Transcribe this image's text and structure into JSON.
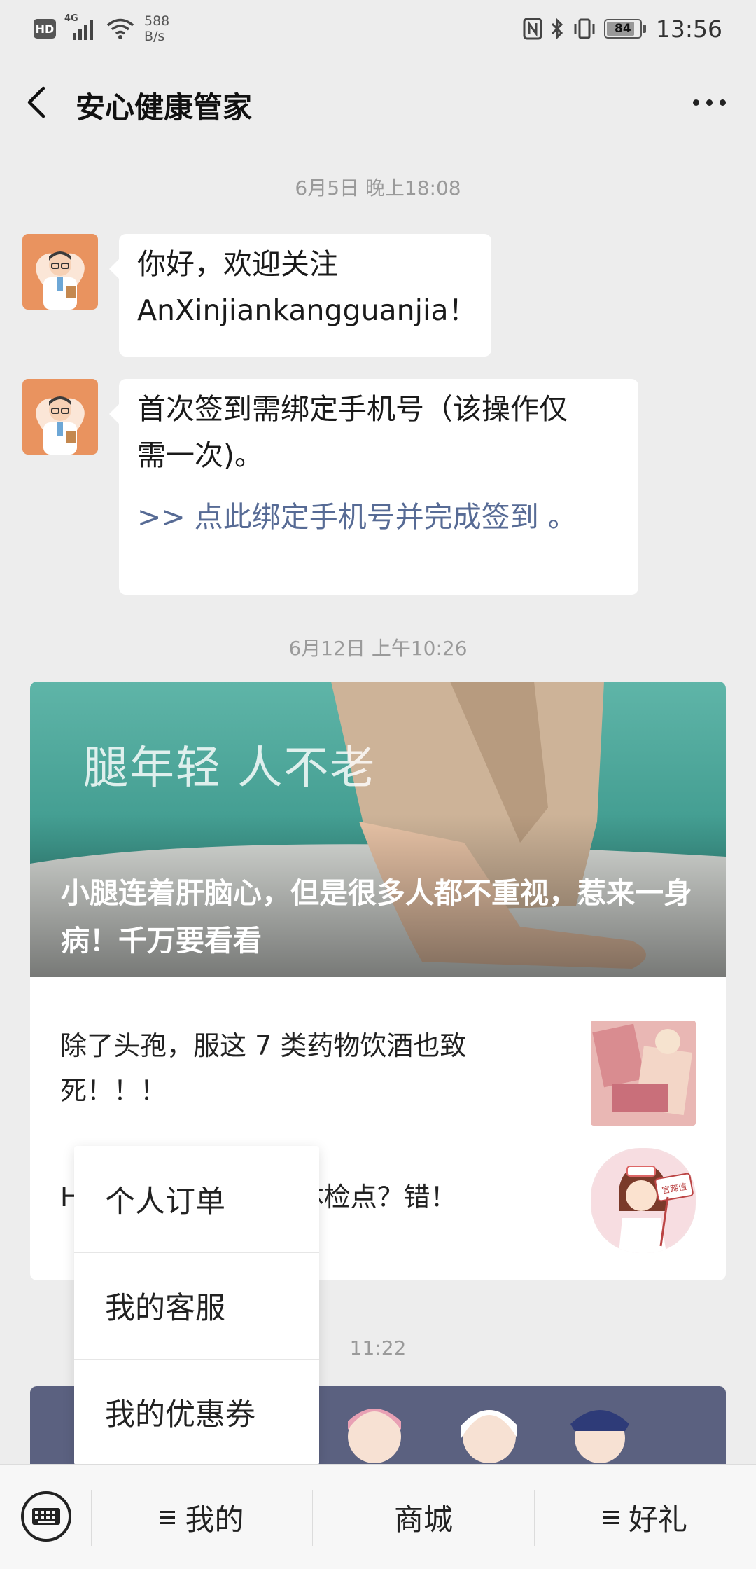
{
  "status_bar": {
    "hd": "HD",
    "network": "4G",
    "speed_value": "588",
    "speed_unit": "B/s",
    "battery": "84",
    "battery_level": 0.84,
    "time": "13:56"
  },
  "header": {
    "title": "安心健康管家"
  },
  "chat": {
    "timestamp_1": "6月5日 晚上18:08",
    "message_1_line1": "你好，欢迎关注",
    "message_1_line2": "AnXinjiankangguanjia！",
    "message_2_line1": "首次签到需绑定手机号（该操作仅",
    "message_2_line2": "需一次)。",
    "message_2_link": ">> 点此绑定手机号并完成签到 。",
    "timestamp_2": "6月12日 上午10:26",
    "timestamp_3": "11:22"
  },
  "article_card": {
    "hero_overlay_text": "腿年轻  人不老",
    "hero_title": "小腿连着肝脑心，但是很多人都不重视，惹来一身病！千万要看看",
    "item_1": "除了头孢，服这 7 类药物饮酒也致死！！！",
    "item_2_prefix": "H",
    "item_2_suffix": "体检点？错！",
    "thumb_2_label": "官蹄值"
  },
  "popup_menu": {
    "items": [
      "个人订单",
      "我的客服",
      "我的优惠券"
    ]
  },
  "bottom_bar": {
    "tabs": [
      "我的",
      "商城",
      "好礼"
    ]
  },
  "colors": {
    "background": "#ededed",
    "link": "#576b95",
    "hero_teal": "#4fa89c"
  },
  "icons": [
    "hd-badge",
    "signal-icon",
    "wifi-icon",
    "nfc-icon",
    "bluetooth-icon",
    "vibrate-icon",
    "battery-icon",
    "back-icon",
    "more-icon",
    "doctor-avatar",
    "keyboard-icon",
    "menu-lines-icon"
  ]
}
